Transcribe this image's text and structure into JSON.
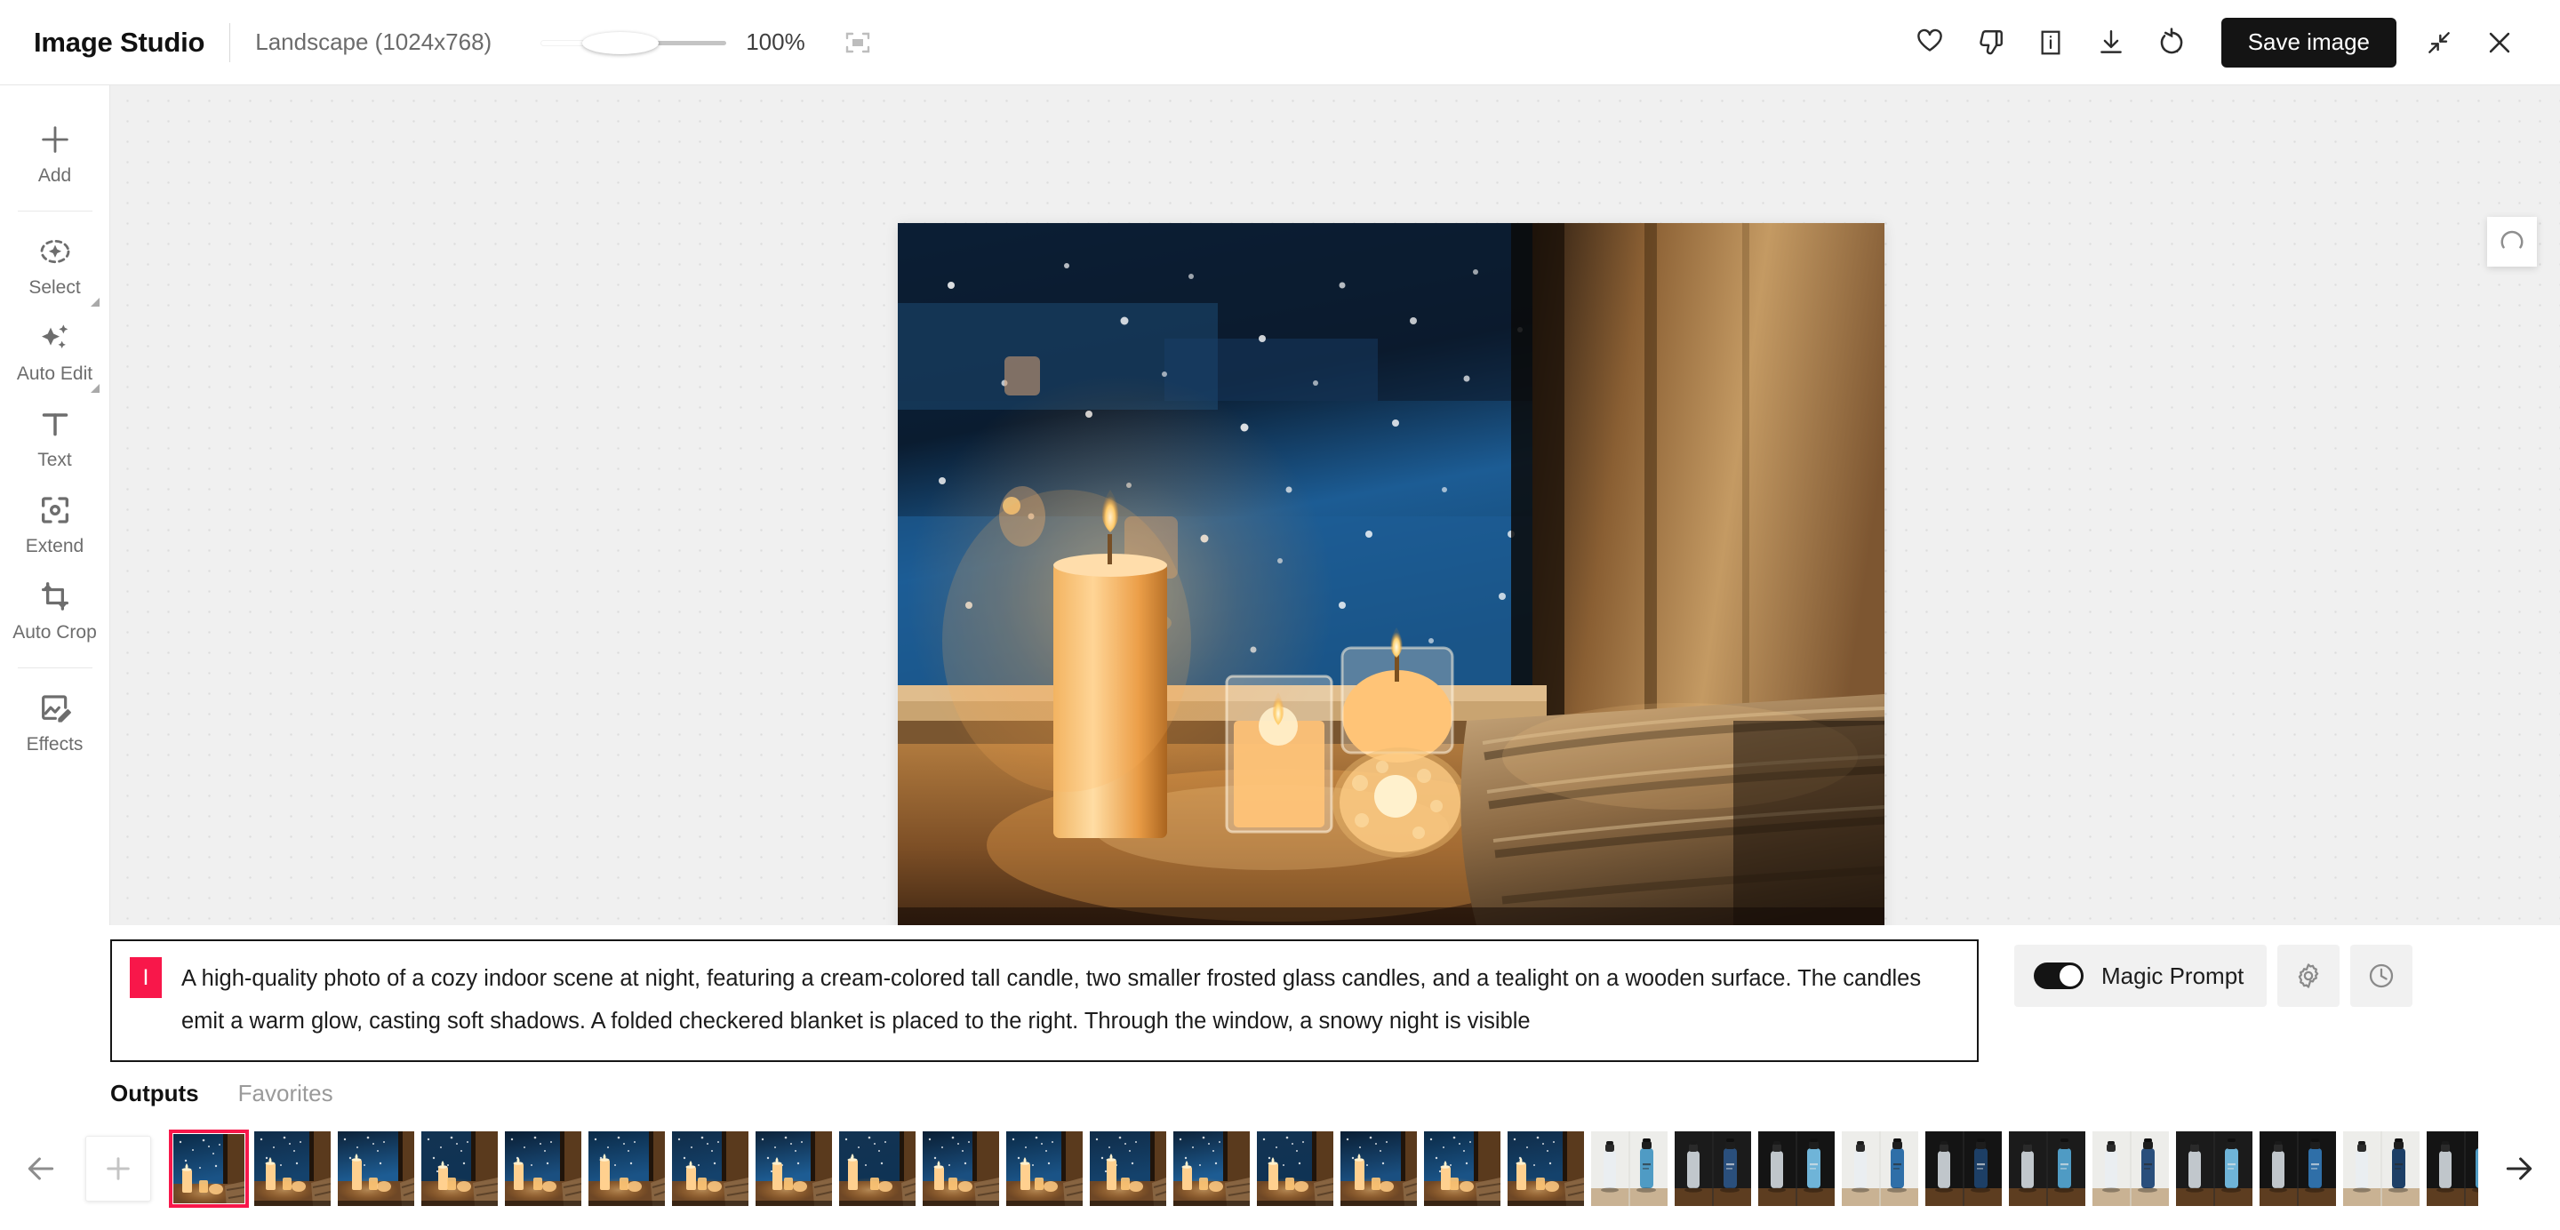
{
  "header": {
    "app_title": "Image Studio",
    "aspect_label": "Landscape (1024x768)",
    "zoom_percent": "100%",
    "zoom_slider_value": 28,
    "fit_icon": "fit-to-screen-icon",
    "actions": [
      {
        "name": "favorite-button",
        "icon": "heart-icon"
      },
      {
        "name": "dislike-button",
        "icon": "thumbs-down-icon"
      },
      {
        "name": "info-button",
        "icon": "info-icon"
      },
      {
        "name": "download-button",
        "icon": "download-icon"
      },
      {
        "name": "regenerate-button",
        "icon": "refresh-icon"
      }
    ],
    "save_label": "Save image",
    "collapse_icon": "collapse-arrows-icon",
    "close_icon": "close-icon"
  },
  "sidebar": {
    "items": [
      {
        "label": "Add",
        "icon": "plus-icon",
        "submenu": false
      },
      {
        "label": "Select",
        "icon": "select-icon",
        "submenu": true
      },
      {
        "label": "Auto Edit",
        "icon": "sparkles-icon",
        "submenu": true
      },
      {
        "label": "Text",
        "icon": "text-icon",
        "submenu": false
      },
      {
        "label": "Extend",
        "icon": "extend-icon",
        "submenu": false
      },
      {
        "label": "Auto Crop",
        "icon": "auto-crop-icon",
        "submenu": false
      },
      {
        "label": "Effects",
        "icon": "effects-icon",
        "submenu": false
      }
    ]
  },
  "canvas": {
    "image_alt": "Cozy indoor night scene with candles on a wooden windowsill and snow outside",
    "loading_icon": "spinner-icon"
  },
  "prompt": {
    "badge_letter": "I",
    "badge_color": "#f8174a",
    "text": "A high-quality photo of a cozy indoor scene at night, featuring a cream-colored tall candle, two smaller frosted glass candles, and a tealight on a wooden surface. The candles emit a warm glow, casting soft shadows. A folded checkered blanket is placed to the right. Through the window, a snowy night is visible",
    "magic_prompt_label": "Magic Prompt",
    "magic_prompt_on": true,
    "settings_icon": "gear-icon",
    "history_icon": "clock-icon"
  },
  "tabs": [
    {
      "label": "Outputs",
      "active": true
    },
    {
      "label": "Favorites",
      "active": false
    }
  ],
  "filmstrip": {
    "prev_icon": "arrow-left-icon",
    "next_icon": "arrow-right-icon",
    "add_icon": "plus-icon",
    "selected_index": 0,
    "selected_color": "#f8174a",
    "thumbnails": [
      {
        "kind": "candle-night-window",
        "selected": true
      },
      {
        "kind": "candle-night-window",
        "selected": false
      },
      {
        "kind": "candle-night-window",
        "selected": false
      },
      {
        "kind": "candle-night-window",
        "selected": false
      },
      {
        "kind": "candle-night-window",
        "selected": false
      },
      {
        "kind": "candle-night-window",
        "selected": false
      },
      {
        "kind": "candle-night-window",
        "selected": false
      },
      {
        "kind": "candle-night-window",
        "selected": false
      },
      {
        "kind": "candle-night-window",
        "selected": false
      },
      {
        "kind": "candle-night-window",
        "selected": false
      },
      {
        "kind": "candle-night-window",
        "selected": false
      },
      {
        "kind": "candle-night-window",
        "selected": false
      },
      {
        "kind": "candle-night-window",
        "selected": false
      },
      {
        "kind": "candle-night-window",
        "selected": false
      },
      {
        "kind": "candle-night-window",
        "selected": false
      },
      {
        "kind": "candle-night-window",
        "selected": false
      },
      {
        "kind": "candle-night-window",
        "selected": false
      },
      {
        "kind": "water-bottle-product",
        "selected": false
      },
      {
        "kind": "water-bottle-product",
        "selected": false
      },
      {
        "kind": "water-bottle-product",
        "selected": false
      },
      {
        "kind": "water-bottle-product",
        "selected": false
      },
      {
        "kind": "water-bottle-product",
        "selected": false
      },
      {
        "kind": "water-bottle-product",
        "selected": false
      },
      {
        "kind": "water-bottle-product",
        "selected": false
      },
      {
        "kind": "water-bottle-product",
        "selected": false
      },
      {
        "kind": "water-bottle-product",
        "selected": false
      },
      {
        "kind": "water-bottle-product",
        "selected": false
      },
      {
        "kind": "water-bottle-product",
        "selected": false
      }
    ]
  }
}
